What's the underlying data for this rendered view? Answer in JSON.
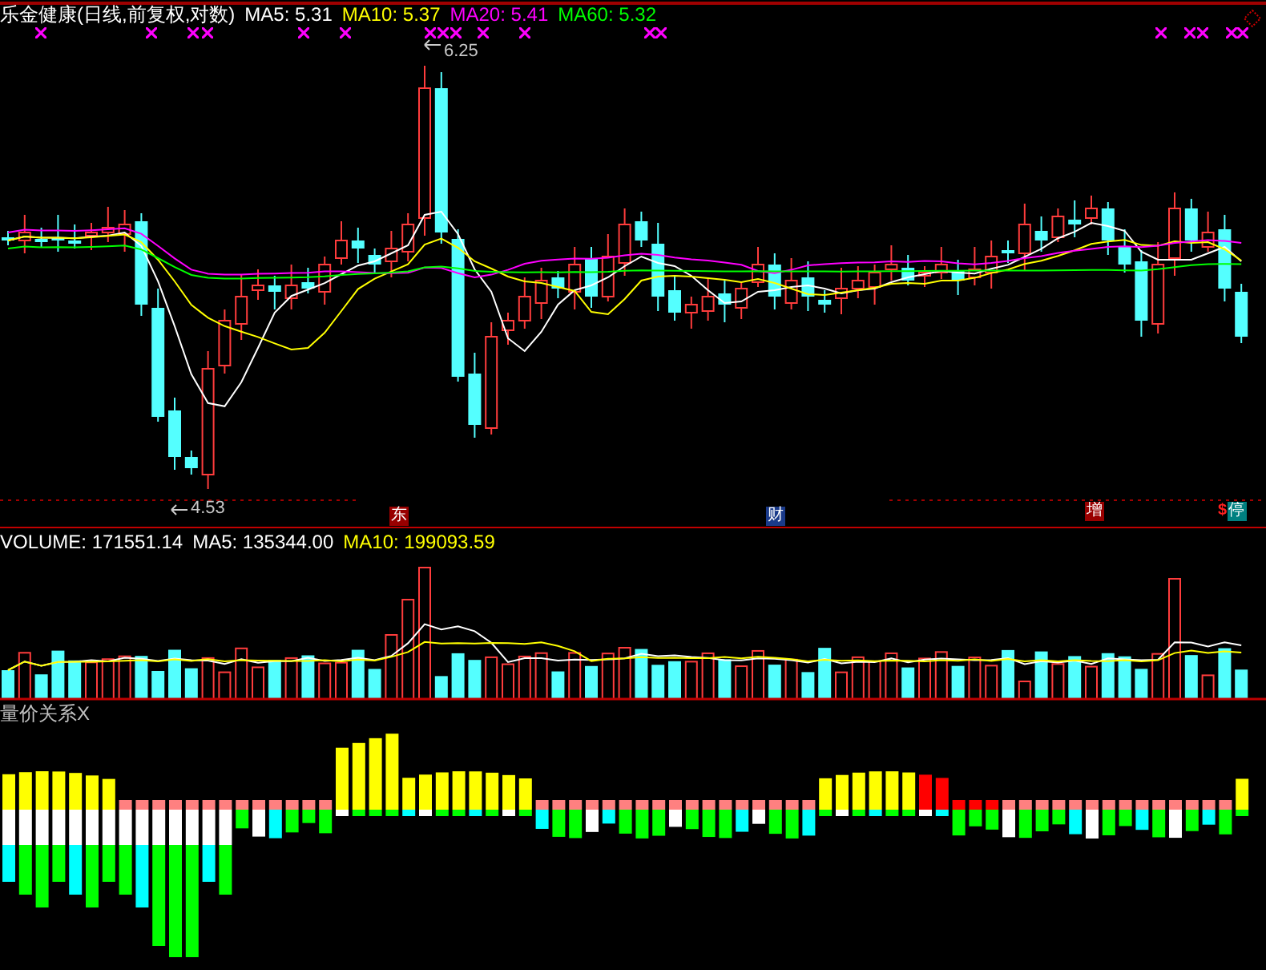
{
  "price_panel": {
    "title": "乐金健康(日线,前复权,对数)",
    "indicators": [
      {
        "label": "MA5: 5.31",
        "color": "#ffffff"
      },
      {
        "label": "MA10: 5.37",
        "color": "#ffff00"
      },
      {
        "label": "MA20: 5.41",
        "color": "#ff00ff"
      },
      {
        "label": "MA60: 5.32",
        "color": "#00ff00"
      }
    ],
    "high_label": "6.25",
    "low_label": "4.53",
    "event_markers": [
      {
        "text": "东",
        "color": "#990000"
      },
      {
        "text": "财",
        "color": "#1a3a8a"
      },
      {
        "text": "增",
        "color": "#990000"
      },
      {
        "text": "停",
        "color": "#008080",
        "symbol": "$"
      }
    ]
  },
  "volume_panel": {
    "indicators": [
      {
        "label": "VOLUME: 171551.14",
        "color": "#ffffff"
      },
      {
        "label": "MA5: 135344.00",
        "color": "#ffffff"
      },
      {
        "label": "MA10: 199093.59",
        "color": "#ffff00"
      }
    ]
  },
  "indicator_panel": {
    "title": "量价关系X"
  }
}
